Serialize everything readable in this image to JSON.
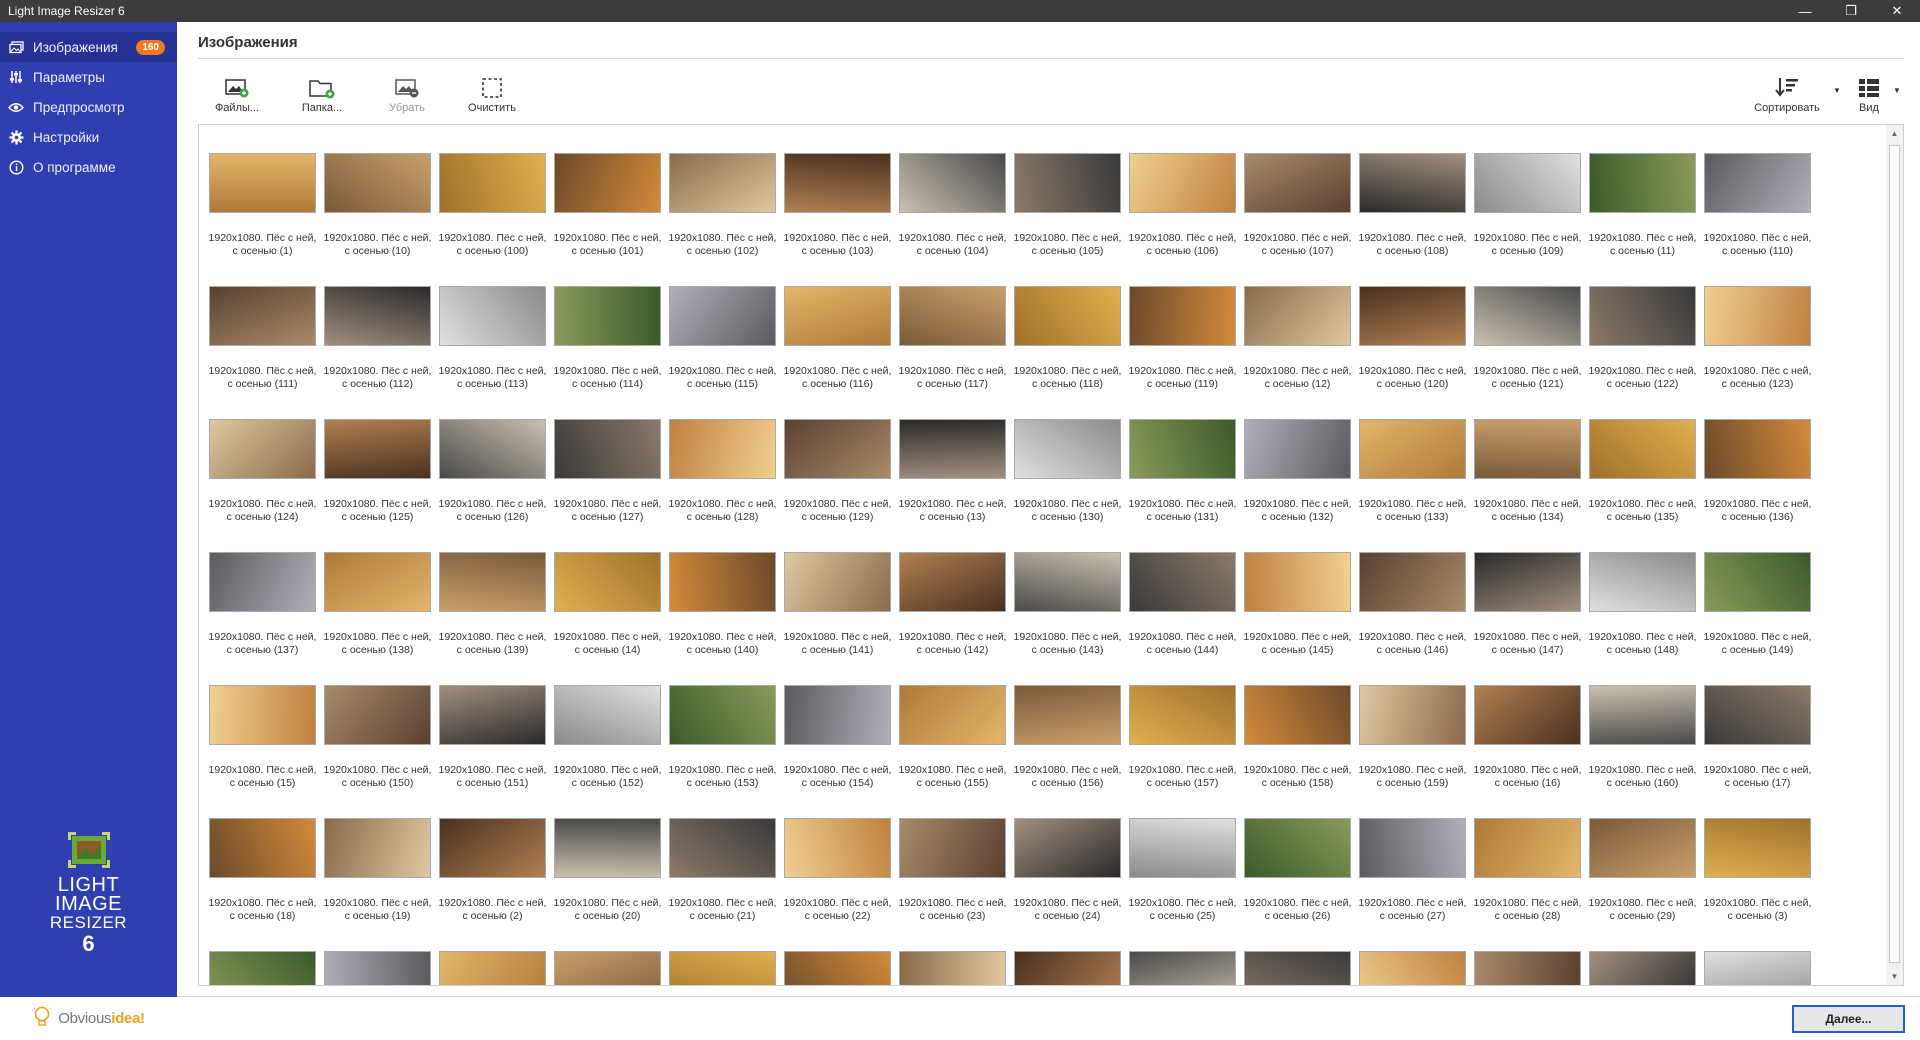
{
  "window": {
    "title": "Light Image Resizer 6"
  },
  "sidebar": {
    "items": [
      {
        "label": "Изображения",
        "icon": "images-icon",
        "badge": "160",
        "active": true
      },
      {
        "label": "Параметры",
        "icon": "sliders-icon"
      },
      {
        "label": "Предпросмотр",
        "icon": "eye-icon"
      },
      {
        "label": "Настройки",
        "icon": "gear-icon"
      },
      {
        "label": "О программе",
        "icon": "info-icon"
      }
    ],
    "logo": {
      "line1": "LIGHT",
      "line2": "IMAGE",
      "line3": "RESIZER",
      "line4": "6"
    },
    "brand": {
      "part1": "Obvious",
      "part2": "idea!"
    }
  },
  "main": {
    "title": "Изображения"
  },
  "toolbar": {
    "files": "Файлы...",
    "folder": "Папка...",
    "remove": "Убрать",
    "clear": "Очистить",
    "sort": "Сортировать",
    "view": "Вид"
  },
  "footer": {
    "next": "Далее..."
  },
  "colors": {
    "sidebar": "#2f3fb0",
    "sidebar_active": "#263195",
    "badge": "#f07a1d",
    "accent": "#1f63c6"
  },
  "captions": [
    "1920x1080. Пёс с ней, с осенью (1)",
    "1920x1080. Пёс с ней, с осенью (10)",
    "1920x1080. Пёс с ней, с осенью (100)",
    "1920x1080. Пёс с ней, с осенью (101)",
    "1920x1080. Пёс с ней, с осенью (102)",
    "1920x1080. Пёс с ней, с осенью (103)",
    "1920x1080. Пёс с ней, с осенью (104)",
    "1920x1080. Пёс с ней, с осенью (105)",
    "1920x1080. Пёс с ней, с осенью (106)",
    "1920x1080. Пёс с ней, с осенью (107)",
    "1920x1080. Пёс с ней, с осенью (108)",
    "1920x1080. Пёс с ней, с осенью (109)",
    "1920x1080. Пёс с ней, с осенью (11)",
    "1920x1080. Пёс с ней, с осенью (110)",
    "1920x1080. Пёс с ней, с осенью (111)",
    "1920x1080. Пёс с ней, с осенью (112)",
    "1920x1080. Пёс с ней, с осенью (113)",
    "1920x1080. Пёс с ней, с осенью (114)",
    "1920x1080. Пёс с ней, с осенью (115)",
    "1920x1080. Пёс с ней, с осенью (116)",
    "1920x1080. Пёс с ней, с осенью (117)",
    "1920x1080. Пёс с ней, с осенью (118)",
    "1920x1080. Пёс с ней, с осенью (119)",
    "1920x1080. Пёс с ней, с осенью (12)",
    "1920x1080. Пёс с ней, с осенью (120)",
    "1920x1080. Пёс с ней, с осенью (121)",
    "1920x1080. Пёс с ней, с осенью (122)",
    "1920x1080. Пёс с ней, с осенью (123)",
    "1920x1080. Пёс с ней, с осенью (124)",
    "1920x1080. Пёс с ней, с осенью (125)",
    "1920x1080. Пёс с ней, с осенью (126)",
    "1920x1080. Пёс с ней, с осенью (127)",
    "1920x1080. Пёс с ней, с осенью (128)",
    "1920x1080. Пёс с ней, с осенью (129)",
    "1920x1080. Пёс с ней, с осенью (13)",
    "1920x1080. Пёс с ней, с осенью (130)",
    "1920x1080. Пёс с ней, с осенью (131)",
    "1920x1080. Пёс с ней, с осенью (132)",
    "1920x1080. Пёс с ней, с осенью (133)",
    "1920x1080. Пёс с ней, с осенью (134)",
    "1920x1080. Пёс с ней, с осенью (135)",
    "1920x1080. Пёс с ней, с осенью (136)",
    "1920x1080. Пёс с ней, с осенью (137)",
    "1920x1080. Пёс с ней, с осенью (138)",
    "1920x1080. Пёс с ней, с осенью (139)",
    "1920x1080. Пёс с ней, с осенью (14)",
    "1920x1080. Пёс с ней, с осенью (140)",
    "1920x1080. Пёс с ней, с осенью (141)",
    "1920x1080. Пёс с ней, с осенью (142)",
    "1920x1080. Пёс с ней, с осенью (143)",
    "1920x1080. Пёс с ней, с осенью (144)",
    "1920x1080. Пёс с ней, с осенью (145)",
    "1920x1080. Пёс с ней, с осенью (146)",
    "1920x1080. Пёс с ней, с осенью (147)",
    "1920x1080. Пёс с ней, с осенью (148)",
    "1920x1080. Пёс с ней, с осенью (149)",
    "1920x1080. Пёс с ней, с осенью (15)",
    "1920x1080. Пёс с ней, с осенью (150)",
    "1920x1080. Пёс с ней, с осенью (151)",
    "1920x1080. Пёс с ней, с осенью (152)",
    "1920x1080. Пёс с ней, с осенью (153)",
    "1920x1080. Пёс с ней, с осенью (154)",
    "1920x1080. Пёс с ней, с осенью (155)",
    "1920x1080. Пёс с ней, с осенью (156)",
    "1920x1080. Пёс с ней, с осенью (157)",
    "1920x1080. Пёс с ней, с осенью (158)",
    "1920x1080. Пёс с ней, с осенью (159)",
    "1920x1080. Пёс с ней, с осенью (16)",
    "1920x1080. Пёс с ней, с осенью (160)",
    "1920x1080. Пёс с ней, с осенью (17)",
    "1920x1080. Пёс с ней, с осенью (18)",
    "1920x1080. Пёс с ней, с осенью (19)",
    "1920x1080. Пёс с ней, с осенью (2)",
    "1920x1080. Пёс с ней, с осенью (20)",
    "1920x1080. Пёс с ней, с осенью (21)",
    "1920x1080. Пёс с ней, с осенью (22)",
    "1920x1080. Пёс с ней, с осенью (23)",
    "1920x1080. Пёс с ней, с осенью (24)",
    "1920x1080. Пёс с ней, с осенью (25)",
    "1920x1080. Пёс с ней, с осенью (26)",
    "1920x1080. Пёс с ней, с осенью (27)",
    "1920x1080. Пёс с ней, с осенью (28)",
    "1920x1080. Пёс с ней, с осенью (29)",
    "1920x1080. Пёс с ней, с осенью (3)",
    "",
    "",
    "",
    "",
    "",
    "",
    "",
    "",
    "",
    "",
    "",
    "",
    "",
    ""
  ]
}
